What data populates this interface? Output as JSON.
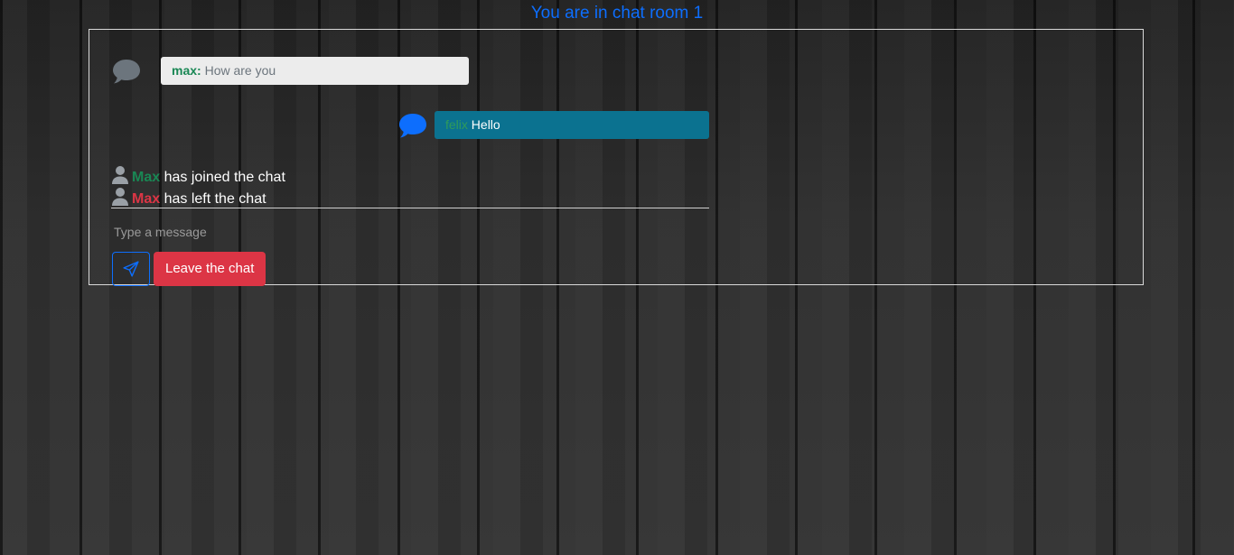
{
  "header": {
    "title": "You are in chat room 1"
  },
  "messages": [
    {
      "author": "max:",
      "text": "How are you",
      "icon": "chat-bubble-icon",
      "icon_color": "#6c757d",
      "background": "#ececec"
    },
    {
      "author": "felix",
      "text": "Hello",
      "icon": "chat-bubble-icon",
      "icon_color": "#0d6efd",
      "background": "#0b7290"
    }
  ],
  "events": [
    {
      "icon": "user-icon",
      "user": "Max",
      "text": "has joined the chat",
      "user_color": "#198754"
    },
    {
      "icon": "user-icon",
      "user": "Max",
      "text": "has left the chat",
      "user_color": "#dc3545"
    }
  ],
  "composer": {
    "placeholder": "Type a message",
    "value": "",
    "send_icon": "send-icon",
    "leave_label": "Leave the chat"
  },
  "colors": {
    "accent": "#0d6efd",
    "danger": "#dc3545",
    "success": "#198754"
  }
}
